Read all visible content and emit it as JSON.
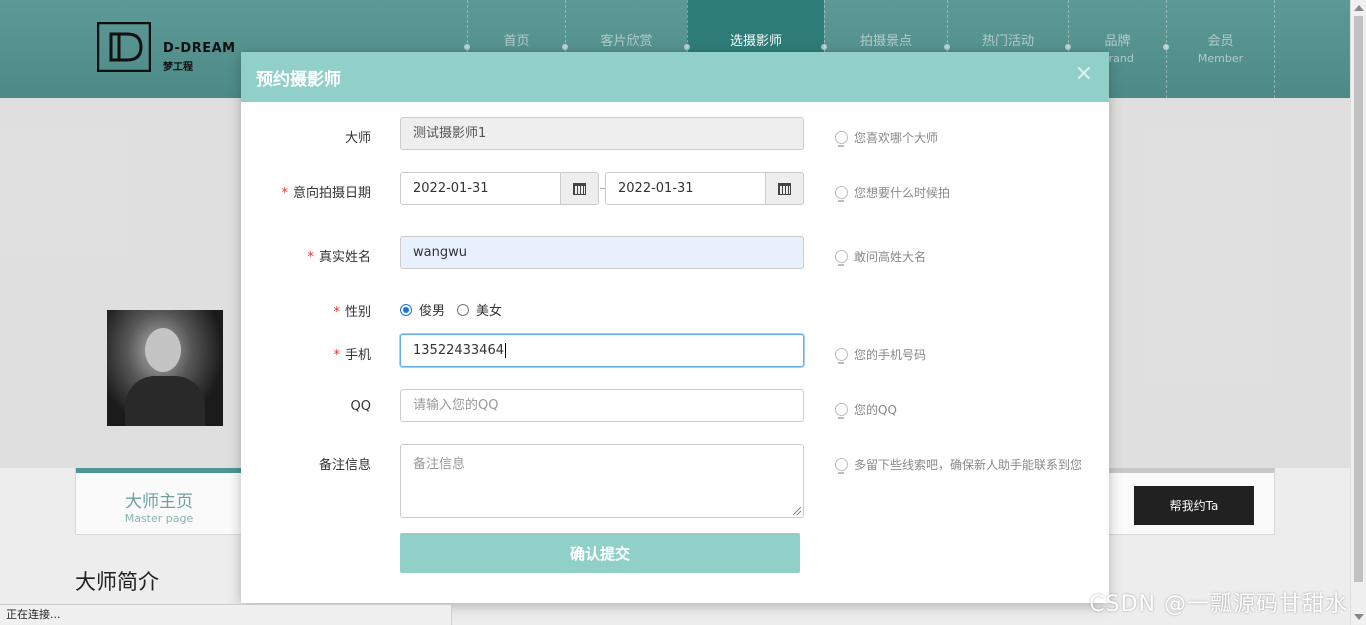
{
  "site": {
    "logo_text": "D-DREAM",
    "logo_sub": "梦工程",
    "nav": [
      {
        "cn": "首页",
        "en": ""
      },
      {
        "cn": "客片欣赏",
        "en": ""
      },
      {
        "cn": "选摄影师",
        "en": ""
      },
      {
        "cn": "拍摄景点",
        "en": ""
      },
      {
        "cn": "热门活动",
        "en": ""
      },
      {
        "cn": "品牌",
        "en": "Brand"
      },
      {
        "cn": "会员",
        "en": "Member"
      }
    ],
    "active_nav_index": 2,
    "tab_main_cn": "大师主页",
    "tab_main_en": "Master page",
    "help_button": "帮我约Ta",
    "intro_title": "大师简介"
  },
  "modal": {
    "title": "预约摄影师",
    "close": "×",
    "fields": {
      "master": {
        "label": "大师",
        "value": "测试摄影师1",
        "hint": "您喜欢哪个大师"
      },
      "date": {
        "label": "意向拍摄日期",
        "start": "2022-01-31",
        "end": "2022-01-31",
        "hint": "您想要什么时候拍"
      },
      "name": {
        "label": "真实姓名",
        "value": "wangwu",
        "hint": "敢问高姓大名"
      },
      "gender": {
        "label": "性别",
        "options": [
          "俊男",
          "美女"
        ],
        "selected": "俊男"
      },
      "phone": {
        "label": "手机",
        "value": "13522433464",
        "hint": "您的手机号码"
      },
      "qq": {
        "label": "QQ",
        "placeholder": "请输入您的QQ",
        "hint": "您的QQ"
      },
      "remark": {
        "label": "备注信息",
        "placeholder": "备注信息",
        "hint": "多留下些线索吧，确保新人助手能联系到您"
      }
    },
    "submit": "确认提交"
  },
  "browser": {
    "status": "正在连接..."
  },
  "watermark": "CSDN @一瓢源码甘甜水",
  "colors": {
    "header": "#91d0c9",
    "topbar": "#5f9d9a",
    "required": "#e5302b"
  }
}
